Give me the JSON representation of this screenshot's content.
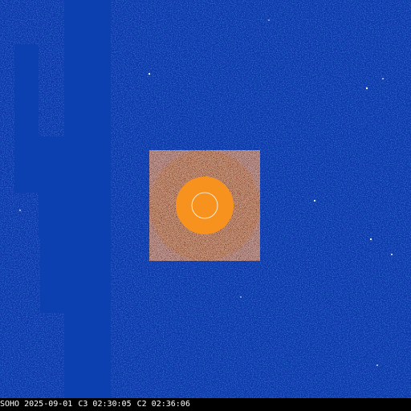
{
  "image": {
    "observatory": "SOHO",
    "date": "2025-09-01",
    "c3_label": "C3",
    "c3_time": "02:30:05",
    "c2_label": "C2",
    "c2_time": "02:36:06"
  },
  "colors": {
    "sky": "#0b35a8",
    "missing_block": "#0c3fb0",
    "occulter": "#f7921e",
    "sun_outline": "#ffffff",
    "inner_field": "#3a1e10",
    "status_background": "#000000",
    "status_text": "#ffffff"
  }
}
